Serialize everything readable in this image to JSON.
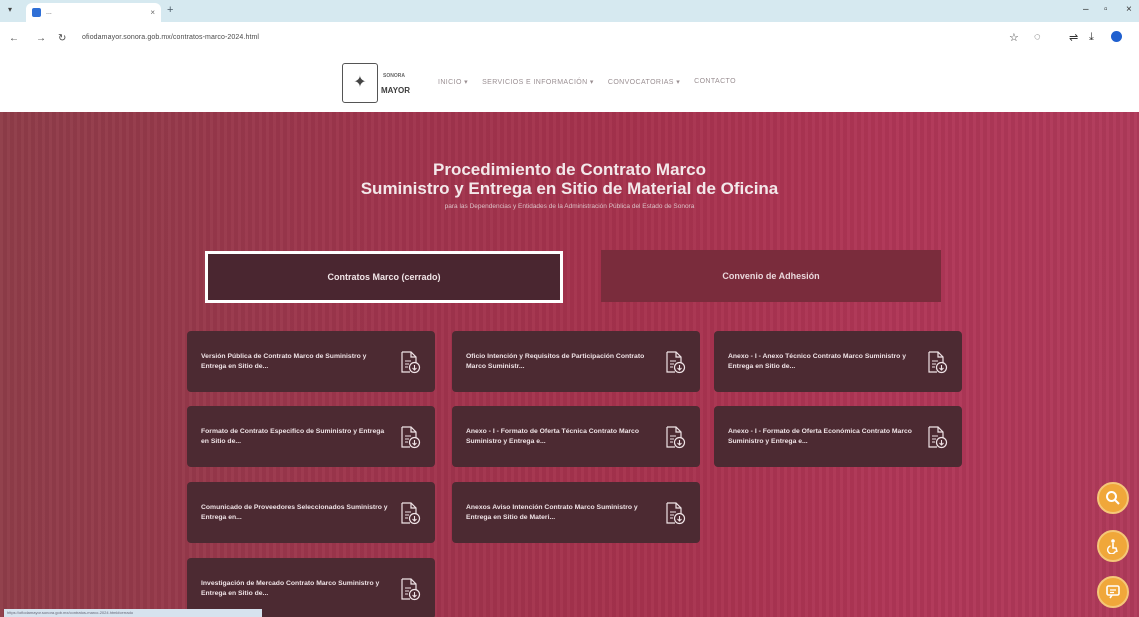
{
  "browser": {
    "tab_title": "...",
    "url": "ofiodamayor.sonora.gob.mx/contratos-marco-2024.html"
  },
  "site": {
    "logo_top": "SONORA",
    "logo_bottom": "MAYOR",
    "nav": [
      "INICIO ▾",
      "SERVICIOS E INFORMACIÓN ▾",
      "CONVOCATORIAS ▾",
      "CONTACTO"
    ]
  },
  "hero": {
    "title_line1": "Procedimiento de Contrato Marco",
    "title_line2": "Suministro y Entrega en Sitio de Material de Oficina",
    "subtitle": "para las Dependencias y Entidades de la Administración Pública del Estado de Sonora",
    "tabs": [
      "Contratos Marco (cerrado)",
      "Convenio de Adhesión"
    ],
    "active_tab": "Contratos Marco (cerrado)"
  },
  "documents": [
    "Versión Pública de Contrato Marco de Suministro y Entrega en Sitio de...",
    "Oficio Intención y Requisitos de Participación Contrato Marco Suministr...",
    "Anexo - I - Anexo Técnico Contrato Marco Suministro y Entrega en Sitio de...",
    "Formato de Contrato Especifico de Suministro y Entrega en Sitio de...",
    "Anexo - I - Formato de Oferta Técnica Contrato Marco Suministro y Entrega e...",
    "Anexo - I - Formato de Oferta Económica Contrato Marco Suministro y Entrega e...",
    "Comunicado de Proveedores Seleccionados Suministro y Entrega en...",
    "Anexos Aviso Intención Contrato Marco Suministro y Entrega en Sitio de Materi...",
    "Investigación de Mercado Contrato Marco Suministro y Entrega en Sitio de..."
  ],
  "fab_icons": [
    "search-icon",
    "accessibility-icon",
    "chat-icon"
  ],
  "status_url": "https://ofiodamayor.sonora.gob.mx/contratos-marco-2024.html#cerrado",
  "colors": {
    "hero": "#a6324d",
    "card": "#4c2a32",
    "active_tab": "#4a2630",
    "fab": "#f0a73a"
  }
}
